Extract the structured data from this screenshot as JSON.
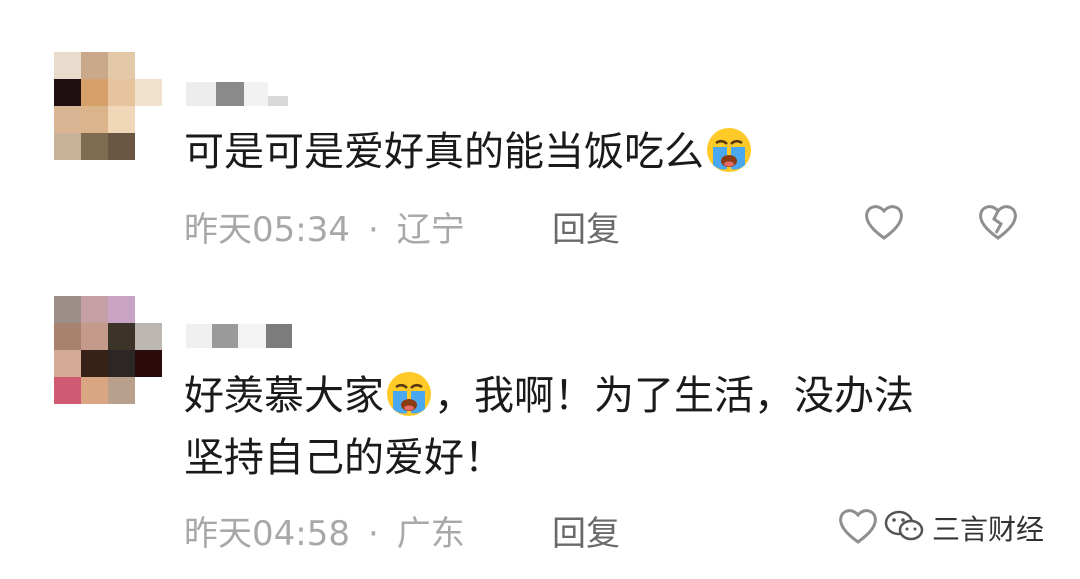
{
  "comments": [
    {
      "text": "可是可是爱好真的能当饭吃么",
      "emoji_icon": "loudly-crying-face-icon",
      "time": "昨天05:34",
      "separator": "·",
      "location": "辽宁",
      "reply_label": "回复"
    },
    {
      "text_line1_a": "好羡慕大家",
      "emoji_icon": "loudly-crying-face-icon",
      "text_line1_b": "，我啊！为了生活，没办法",
      "text_line2": "坚持自己的爱好！",
      "time": "昨天04:58",
      "separator": "·",
      "location": "广东",
      "reply_label": "回复"
    }
  ],
  "watermark": {
    "label": "三言财经",
    "icon": "wechat-icon"
  },
  "colors": {
    "text": "#1a1a1a",
    "meta": "#a8a8a8",
    "reply": "#6a6a6a",
    "icon": "#8f8f8f"
  }
}
